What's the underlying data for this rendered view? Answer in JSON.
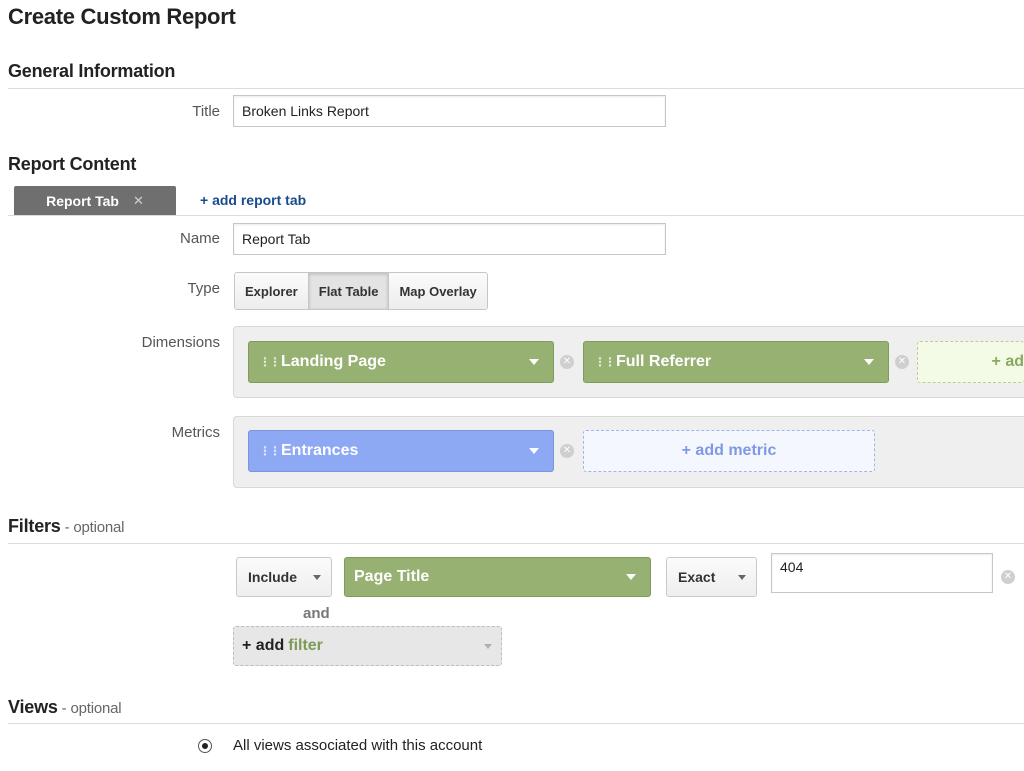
{
  "page": {
    "title": "Create Custom Report"
  },
  "general": {
    "heading": "General Information",
    "title_label": "Title",
    "title_value": "Broken Links Report"
  },
  "content": {
    "heading": "Report Content",
    "tabs": [
      {
        "label": "Report Tab",
        "close": "✕"
      }
    ],
    "add_tab": "+ add report tab",
    "name_label": "Name",
    "name_value": "Report Tab",
    "type_label": "Type",
    "types": [
      {
        "label": "Explorer",
        "active": false
      },
      {
        "label": "Flat Table",
        "active": true
      },
      {
        "label": "Map Overlay",
        "active": false
      }
    ],
    "dimensions_label": "Dimensions",
    "dimensions": [
      {
        "label": "Landing Page"
      },
      {
        "label": "Full Referrer"
      }
    ],
    "add_dimension": "+ ad",
    "metrics_label": "Metrics",
    "metrics": [
      {
        "label": "Entrances"
      }
    ],
    "add_metric": "+ add metric"
  },
  "filters": {
    "heading": "Filters",
    "optional": " - optional",
    "include": "Include",
    "dimension": "Page Title",
    "match": "Exact",
    "value": "404",
    "and": "and",
    "add_prefix": "+ add",
    "add_word": "filter"
  },
  "views": {
    "heading": "Views",
    "optional": " - optional",
    "option_label": "All views associated with this account"
  },
  "colors": {
    "dimension_chip": "#97b173",
    "metric_chip": "#8ea9f3",
    "link": "#1a4c8c",
    "add_dimension_bg": "#f3fbe6",
    "add_metric_bg": "#f4f7fe"
  }
}
